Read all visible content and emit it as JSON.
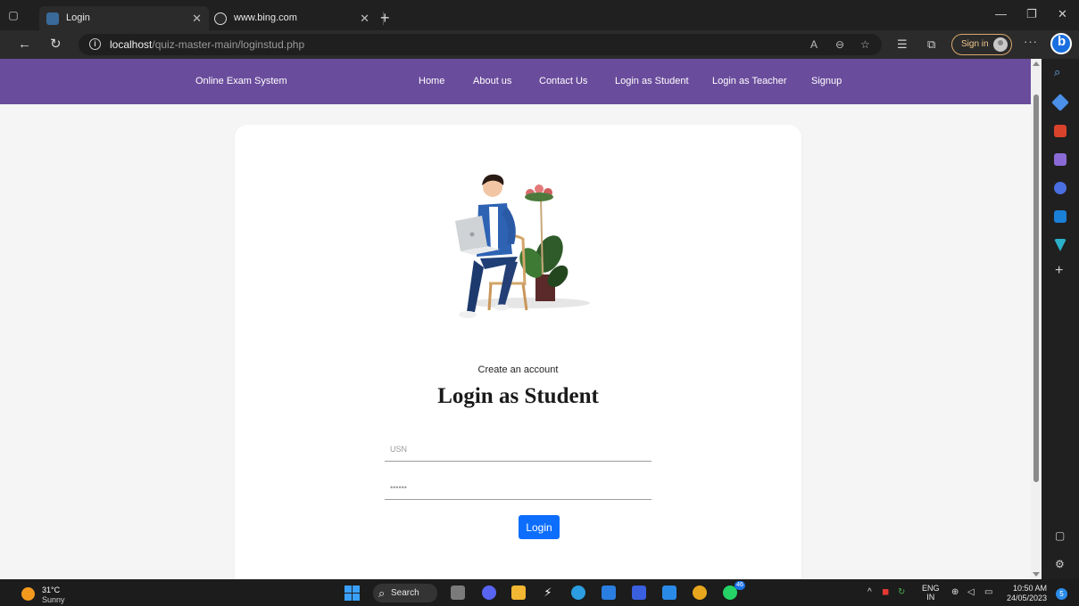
{
  "browser": {
    "tabs": [
      {
        "title": "Login",
        "favicon": "quiz-favicon",
        "active": true
      },
      {
        "title": "www.bing.com",
        "favicon": "bing-favicon",
        "active": false
      }
    ],
    "address": {
      "host": "localhost",
      "path": "/quiz-master-main/loginstud.php"
    },
    "signin_label": "Sign in"
  },
  "site": {
    "brand": "Online Exam System",
    "nav": [
      "Home",
      "About us",
      "Contact Us",
      "Login as Student",
      "Login as Teacher",
      "Signup"
    ],
    "accent_color": "#6a4c9c"
  },
  "login": {
    "subtitle": "Create an account",
    "title": "Login as Student",
    "usn_placeholder": "USN",
    "password_placeholder": "••••••",
    "button_label": "Login",
    "button_color": "#0d6efd"
  },
  "taskbar": {
    "temperature": "31°C",
    "condition": "Sunny",
    "search_label": "Search",
    "lang_line1": "ENG",
    "lang_line2": "IN",
    "time": "10:50 AM",
    "date": "24/05/2023",
    "whatsapp_badge": "46",
    "notification_count": "5"
  }
}
